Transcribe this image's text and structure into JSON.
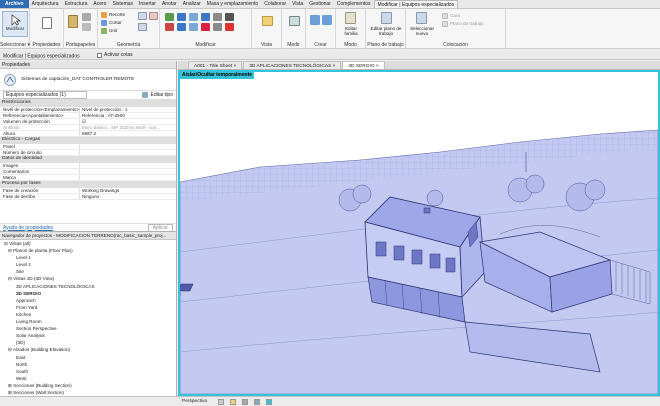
{
  "ribbon_tabs": [
    "Archivo",
    "Arquitectura",
    "Estructura",
    "Acero",
    "Sistemas",
    "Insertar",
    "Anotar",
    "Analizar",
    "Masa y emplazamiento",
    "Colaborar",
    "Vista",
    "Gestionar",
    "Complementos",
    "Modificar | Equipos especializados"
  ],
  "ribbon_active_tab": "Modificar | Equipos especializados",
  "ribbon": {
    "modify_label": "Modificar",
    "select_label": "Seleccionar ▾",
    "properties_label": "Propiedades",
    "clipboard_label": "Portapapeles",
    "recortar": "Recorte",
    "cortar": "Cortar",
    "unir": "Unir",
    "geometry_label": "Geometría",
    "modify_group_label": "Modificar",
    "view_label": "Vista",
    "measure_label": "Medir",
    "create_label": "Crear",
    "mode_label": "Modo",
    "edit_family": "Editar familia",
    "edit_workplane": "Editar plano de trabajo",
    "workplane_label": "Plano de trabajo",
    "select_new": "Seleccionar nuevo",
    "host_label": "Cara",
    "host2_label": "Plano de trabajo",
    "placement_label": "Colocación"
  },
  "optionsbar": {
    "context": "Modificar | Equipos especializados",
    "checkbox": "Activar cotas"
  },
  "properties": {
    "title": "Propiedades",
    "type_name": "Sistemas de captación_DAT CONTROLER REMOTE",
    "filter": "Equipos especializados (1)",
    "edit_type": "Editar tipo",
    "sections": [
      {
        "name": "Restricciones",
        "rows": [
          [
            "Nivel de protección<Emplazamiento>",
            "Nivel de protección : 1"
          ],
          [
            "Referencia<Apantallamiento>",
            "Referencia : AT-2500"
          ],
          [
            "Volumen de protección",
            "☑"
          ],
          [
            "Anfitrión",
            "Muro básico : SIP 202mm Wall - con..."
          ],
          [
            "Altura",
            "5987.2"
          ]
        ]
      },
      {
        "name": "Eléctrico - Cargas",
        "rows": [
          [
            "Panel",
            ""
          ],
          [
            "Número de circuito",
            ""
          ]
        ]
      },
      {
        "name": "Datos de identidad",
        "rows": [
          [
            "Imagen",
            ""
          ],
          [
            "Comentarios",
            ""
          ],
          [
            "Marca",
            ""
          ]
        ]
      },
      {
        "name": "Proceso por fases",
        "rows": [
          [
            "Fase de creación",
            "Working Drawings"
          ],
          [
            "Fase de derribo",
            "Ninguno"
          ]
        ]
      }
    ],
    "help_link": "Ayuda de propiedades",
    "apply": "Aplicar"
  },
  "browser": {
    "title": "Navegador de proyectos - MODIFICACION TERRENO(rac_basic_sample_proj...",
    "items": [
      {
        "text": "⊟ Vistas (all)",
        "indent": 1
      },
      {
        "text": "⊟ Planos de planta (Floor Plan)",
        "indent": 2
      },
      {
        "text": "Level 1",
        "indent": 4
      },
      {
        "text": "Level 2",
        "indent": 4
      },
      {
        "text": "Site",
        "indent": 4
      },
      {
        "text": "⊟ Vistas 3D (3D View)",
        "indent": 2
      },
      {
        "text": "3D APLICACIONES TECNOLÓGICAS",
        "indent": 4
      },
      {
        "text": "3D SERGIO",
        "indent": 4,
        "bold": true
      },
      {
        "text": "Approach",
        "indent": 4
      },
      {
        "text": "From Yard",
        "indent": 4
      },
      {
        "text": "Kitchen",
        "indent": 4
      },
      {
        "text": "Living Room",
        "indent": 4
      },
      {
        "text": "Section Perspective",
        "indent": 4
      },
      {
        "text": "Solar Analysis",
        "indent": 4
      },
      {
        "text": "{3D}",
        "indent": 4
      },
      {
        "text": "⊟ Alzados (Building Elevation)",
        "indent": 2
      },
      {
        "text": "East",
        "indent": 4
      },
      {
        "text": "North",
        "indent": 4
      },
      {
        "text": "South",
        "indent": 4
      },
      {
        "text": "West",
        "indent": 4
      },
      {
        "text": "⊞ Secciones (Building Section)",
        "indent": 2
      },
      {
        "text": "⊞ Secciones (Wall Section)",
        "indent": 2
      }
    ]
  },
  "view_tabs": [
    "A001 - Title Sheet",
    "3D APLICACIONES TECNOLÓGICAS",
    "3D SERGIO"
  ],
  "active_view": "3D SERGIO",
  "isolate_label": "Aislar/Ocultar temporalmente",
  "status": {
    "view_mode": "Perspectiva"
  },
  "colors": {
    "accent": "#2e6db4",
    "highlight": "#36c2d8",
    "model": "#aab4ee"
  }
}
